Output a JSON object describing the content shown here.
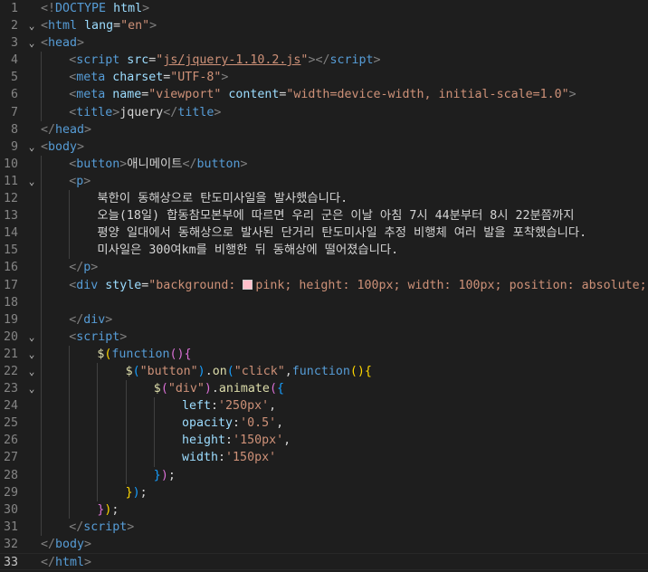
{
  "editor": {
    "language": "html",
    "current_line": 33,
    "colors": {
      "background": "#1e1e1e",
      "tag": "#569cd6",
      "attribute": "#9cdcfe",
      "string": "#ce9178",
      "function": "#dcdcaa",
      "delimiter": "#808080",
      "text": "#d4d4d4"
    },
    "lines": [
      {
        "n": "1",
        "indent": 0,
        "fold": "",
        "tokens": [
          {
            "t": "d",
            "v": "<!"
          },
          {
            "t": "t",
            "v": "DOCTYPE"
          },
          {
            "t": "a",
            "v": " html"
          },
          {
            "t": "d",
            "v": ">"
          }
        ]
      },
      {
        "n": "2",
        "indent": 0,
        "fold": "⌄",
        "tokens": [
          {
            "t": "d",
            "v": "<"
          },
          {
            "t": "t",
            "v": "html"
          },
          {
            "t": "a",
            "v": " lang"
          },
          {
            "t": "x",
            "v": "="
          },
          {
            "t": "s",
            "v": "\"en\""
          },
          {
            "t": "d",
            "v": ">"
          }
        ]
      },
      {
        "n": "3",
        "indent": 0,
        "fold": "⌄",
        "tokens": [
          {
            "t": "d",
            "v": "<"
          },
          {
            "t": "t",
            "v": "head"
          },
          {
            "t": "d",
            "v": ">"
          }
        ]
      },
      {
        "n": "4",
        "indent": 1,
        "fold": "",
        "tokens": [
          {
            "t": "d",
            "v": "<"
          },
          {
            "t": "t",
            "v": "script"
          },
          {
            "t": "a",
            "v": " src"
          },
          {
            "t": "x",
            "v": "="
          },
          {
            "t": "s",
            "v": "\""
          },
          {
            "t": "l",
            "v": "js/jquery-1.10.2.js"
          },
          {
            "t": "s",
            "v": "\""
          },
          {
            "t": "d",
            "v": "></"
          },
          {
            "t": "t",
            "v": "script"
          },
          {
            "t": "d",
            "v": ">"
          }
        ]
      },
      {
        "n": "5",
        "indent": 1,
        "fold": "",
        "tokens": [
          {
            "t": "d",
            "v": "<"
          },
          {
            "t": "t",
            "v": "meta"
          },
          {
            "t": "a",
            "v": " charset"
          },
          {
            "t": "x",
            "v": "="
          },
          {
            "t": "s",
            "v": "\"UTF-8\""
          },
          {
            "t": "d",
            "v": ">"
          }
        ]
      },
      {
        "n": "6",
        "indent": 1,
        "fold": "",
        "tokens": [
          {
            "t": "d",
            "v": "<"
          },
          {
            "t": "t",
            "v": "meta"
          },
          {
            "t": "a",
            "v": " name"
          },
          {
            "t": "x",
            "v": "="
          },
          {
            "t": "s",
            "v": "\"viewport\""
          },
          {
            "t": "a",
            "v": " content"
          },
          {
            "t": "x",
            "v": "="
          },
          {
            "t": "s",
            "v": "\"width=device-width, initial-scale=1.0\""
          },
          {
            "t": "d",
            "v": ">"
          }
        ]
      },
      {
        "n": "7",
        "indent": 1,
        "fold": "",
        "tokens": [
          {
            "t": "d",
            "v": "<"
          },
          {
            "t": "t",
            "v": "title"
          },
          {
            "t": "d",
            "v": ">"
          },
          {
            "t": "x",
            "v": "jquery"
          },
          {
            "t": "d",
            "v": "</"
          },
          {
            "t": "t",
            "v": "title"
          },
          {
            "t": "d",
            "v": ">"
          }
        ]
      },
      {
        "n": "8",
        "indent": 0,
        "fold": "",
        "tokens": [
          {
            "t": "d",
            "v": "</"
          },
          {
            "t": "t",
            "v": "head"
          },
          {
            "t": "d",
            "v": ">"
          }
        ]
      },
      {
        "n": "9",
        "indent": 0,
        "fold": "⌄",
        "tokens": [
          {
            "t": "d",
            "v": "<"
          },
          {
            "t": "t",
            "v": "body"
          },
          {
            "t": "d",
            "v": ">"
          }
        ]
      },
      {
        "n": "10",
        "indent": 1,
        "fold": "",
        "tokens": [
          {
            "t": "d",
            "v": "<"
          },
          {
            "t": "t",
            "v": "button"
          },
          {
            "t": "d",
            "v": ">"
          },
          {
            "t": "x",
            "v": "애니메이트"
          },
          {
            "t": "d",
            "v": "</"
          },
          {
            "t": "t",
            "v": "button"
          },
          {
            "t": "d",
            "v": ">"
          }
        ]
      },
      {
        "n": "11",
        "indent": 1,
        "fold": "⌄",
        "tokens": [
          {
            "t": "d",
            "v": "<"
          },
          {
            "t": "t",
            "v": "p"
          },
          {
            "t": "d",
            "v": ">"
          }
        ]
      },
      {
        "n": "12",
        "indent": 2,
        "fold": "",
        "tokens": [
          {
            "t": "x",
            "v": "북한이 동해상으로 탄도미사일을 발사했습니다."
          }
        ]
      },
      {
        "n": "13",
        "indent": 2,
        "fold": "",
        "tokens": [
          {
            "t": "x",
            "v": "오늘(18일) 합동참모본부에 따르면 우리 군은 이날 아침 7시 44분부터 8시 22분쯤까지"
          }
        ]
      },
      {
        "n": "14",
        "indent": 2,
        "fold": "",
        "tokens": [
          {
            "t": "x",
            "v": "평양 일대에서 동해상으로 발사된 단거리 탄도미사일 추정 비행체 여러 발을 포착했습니다."
          }
        ]
      },
      {
        "n": "15",
        "indent": 2,
        "fold": "",
        "tokens": [
          {
            "t": "x",
            "v": "미사일은 300여km를 비행한 뒤 동해상에 떨어졌습니다."
          }
        ]
      },
      {
        "n": "16",
        "indent": 1,
        "fold": "",
        "tokens": [
          {
            "t": "d",
            "v": "</"
          },
          {
            "t": "t",
            "v": "p"
          },
          {
            "t": "d",
            "v": ">"
          }
        ]
      },
      {
        "n": "17",
        "indent": 1,
        "fold": "",
        "tokens": [
          {
            "t": "d",
            "v": "<"
          },
          {
            "t": "t",
            "v": "div"
          },
          {
            "t": "a",
            "v": " style"
          },
          {
            "t": "x",
            "v": "="
          },
          {
            "t": "s",
            "v": "\"background: "
          },
          {
            "t": "swatch",
            "v": "#ffc0cb"
          },
          {
            "t": "s",
            "v": "pink; height: 100px; width: 100px; position: absolute;\""
          },
          {
            "t": "d",
            "v": ">"
          }
        ]
      },
      {
        "n": "18",
        "indent": 0,
        "fold": "",
        "tokens": []
      },
      {
        "n": "19",
        "indent": 1,
        "fold": "",
        "tokens": [
          {
            "t": "d",
            "v": "</"
          },
          {
            "t": "t",
            "v": "div"
          },
          {
            "t": "d",
            "v": ">"
          }
        ]
      },
      {
        "n": "20",
        "indent": 1,
        "fold": "⌄",
        "tokens": [
          {
            "t": "d",
            "v": "<"
          },
          {
            "t": "t",
            "v": "script"
          },
          {
            "t": "d",
            "v": ">"
          }
        ]
      },
      {
        "n": "21",
        "indent": 2,
        "fold": "⌄",
        "tokens": [
          {
            "t": "f",
            "v": "$"
          },
          {
            "t": "b",
            "v": "("
          },
          {
            "t": "k",
            "v": "function"
          },
          {
            "t": "b2",
            "v": "()"
          },
          {
            "t": "b2",
            "v": "{"
          }
        ]
      },
      {
        "n": "22",
        "indent": 3,
        "fold": "⌄",
        "tokens": [
          {
            "t": "f",
            "v": "$"
          },
          {
            "t": "b3",
            "v": "("
          },
          {
            "t": "s",
            "v": "\"button\""
          },
          {
            "t": "b3",
            "v": ")"
          },
          {
            "t": "x",
            "v": "."
          },
          {
            "t": "f",
            "v": "on"
          },
          {
            "t": "b3",
            "v": "("
          },
          {
            "t": "s",
            "v": "\"click\""
          },
          {
            "t": "x",
            "v": ","
          },
          {
            "t": "k",
            "v": "function"
          },
          {
            "t": "b",
            "v": "()"
          },
          {
            "t": "b",
            "v": "{"
          }
        ]
      },
      {
        "n": "23",
        "indent": 4,
        "fold": "⌄",
        "tokens": [
          {
            "t": "f",
            "v": "$"
          },
          {
            "t": "b2",
            "v": "("
          },
          {
            "t": "s",
            "v": "\"div\""
          },
          {
            "t": "b2",
            "v": ")"
          },
          {
            "t": "x",
            "v": "."
          },
          {
            "t": "f",
            "v": "animate"
          },
          {
            "t": "b2",
            "v": "("
          },
          {
            "t": "b3",
            "v": "{"
          }
        ]
      },
      {
        "n": "24",
        "indent": 5,
        "fold": "",
        "tokens": [
          {
            "t": "n",
            "v": "left"
          },
          {
            "t": "x",
            "v": ":"
          },
          {
            "t": "s",
            "v": "'250px'"
          },
          {
            "t": "x",
            "v": ","
          }
        ]
      },
      {
        "n": "25",
        "indent": 5,
        "fold": "",
        "tokens": [
          {
            "t": "n",
            "v": "opacity"
          },
          {
            "t": "x",
            "v": ":"
          },
          {
            "t": "s",
            "v": "'0.5'"
          },
          {
            "t": "x",
            "v": ","
          }
        ]
      },
      {
        "n": "26",
        "indent": 5,
        "fold": "",
        "tokens": [
          {
            "t": "n",
            "v": "height"
          },
          {
            "t": "x",
            "v": ":"
          },
          {
            "t": "s",
            "v": "'150px'"
          },
          {
            "t": "x",
            "v": ","
          }
        ]
      },
      {
        "n": "27",
        "indent": 5,
        "fold": "",
        "tokens": [
          {
            "t": "n",
            "v": "width"
          },
          {
            "t": "x",
            "v": ":"
          },
          {
            "t": "s",
            "v": "'150px'"
          }
        ]
      },
      {
        "n": "28",
        "indent": 4,
        "fold": "",
        "tokens": [
          {
            "t": "b3",
            "v": "}"
          },
          {
            "t": "b2",
            "v": ")"
          },
          {
            "t": "x",
            "v": ";"
          }
        ]
      },
      {
        "n": "29",
        "indent": 3,
        "fold": "",
        "tokens": [
          {
            "t": "b",
            "v": "}"
          },
          {
            "t": "b3",
            "v": ")"
          },
          {
            "t": "x",
            "v": ";"
          }
        ]
      },
      {
        "n": "30",
        "indent": 2,
        "fold": "",
        "tokens": [
          {
            "t": "b2",
            "v": "}"
          },
          {
            "t": "b",
            "v": ")"
          },
          {
            "t": "x",
            "v": ";"
          }
        ]
      },
      {
        "n": "31",
        "indent": 1,
        "fold": "",
        "tokens": [
          {
            "t": "d",
            "v": "</"
          },
          {
            "t": "t",
            "v": "script"
          },
          {
            "t": "d",
            "v": ">"
          }
        ]
      },
      {
        "n": "32",
        "indent": 0,
        "fold": "",
        "tokens": [
          {
            "t": "d",
            "v": "</"
          },
          {
            "t": "t",
            "v": "body"
          },
          {
            "t": "d",
            "v": ">"
          }
        ]
      },
      {
        "n": "33",
        "indent": 0,
        "fold": "",
        "tokens": [
          {
            "t": "d",
            "v": "</"
          },
          {
            "t": "t",
            "v": "html"
          },
          {
            "t": "d",
            "v": ">"
          }
        ]
      }
    ]
  }
}
